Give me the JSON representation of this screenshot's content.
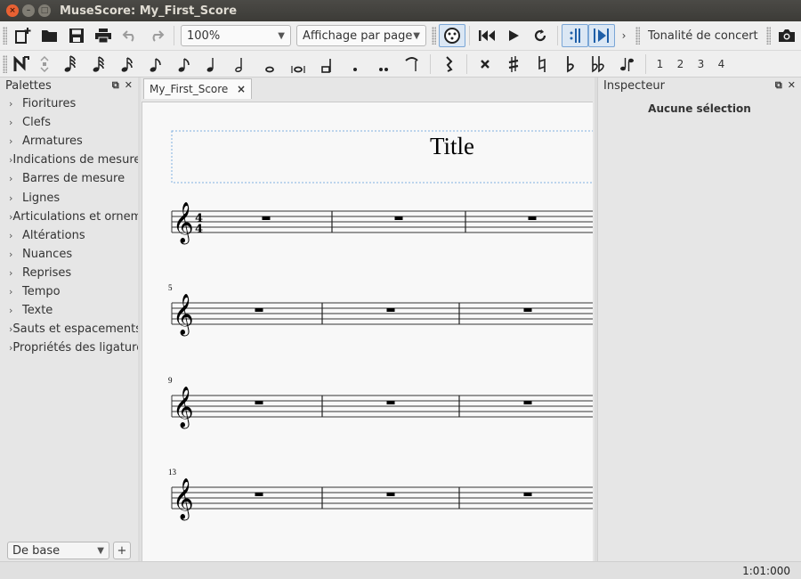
{
  "window": {
    "title": "MuseScore: My_First_Score"
  },
  "toolbar": {
    "zoom": "100%",
    "view_mode": "Affichage par page",
    "concert_pitch": "Tonalité de concert"
  },
  "voices": [
    "1",
    "2",
    "3",
    "4"
  ],
  "palettes": {
    "title": "Palettes",
    "items": [
      "Fioritures",
      "Clefs",
      "Armatures",
      "Indications de mesure",
      "Barres de mesure",
      "Lignes",
      "Articulations et ornements",
      "Altérations",
      "Nuances",
      "Reprises",
      "Tempo",
      "Texte",
      "Sauts et espacements",
      "Propriétés des ligatures"
    ],
    "workspace": "De base",
    "add": "+"
  },
  "document": {
    "tab_label": "My_First_Score",
    "tab_close": "×",
    "score_title": "Title",
    "time_sig": {
      "top": "4",
      "bottom": "4"
    },
    "systems": [
      {
        "measure_number": ""
      },
      {
        "measure_number": "5"
      },
      {
        "measure_number": "9"
      },
      {
        "measure_number": "13"
      }
    ]
  },
  "inspector": {
    "title": "Inspecteur",
    "no_selection": "Aucune sélection"
  },
  "status": {
    "position": "1:01:000"
  }
}
